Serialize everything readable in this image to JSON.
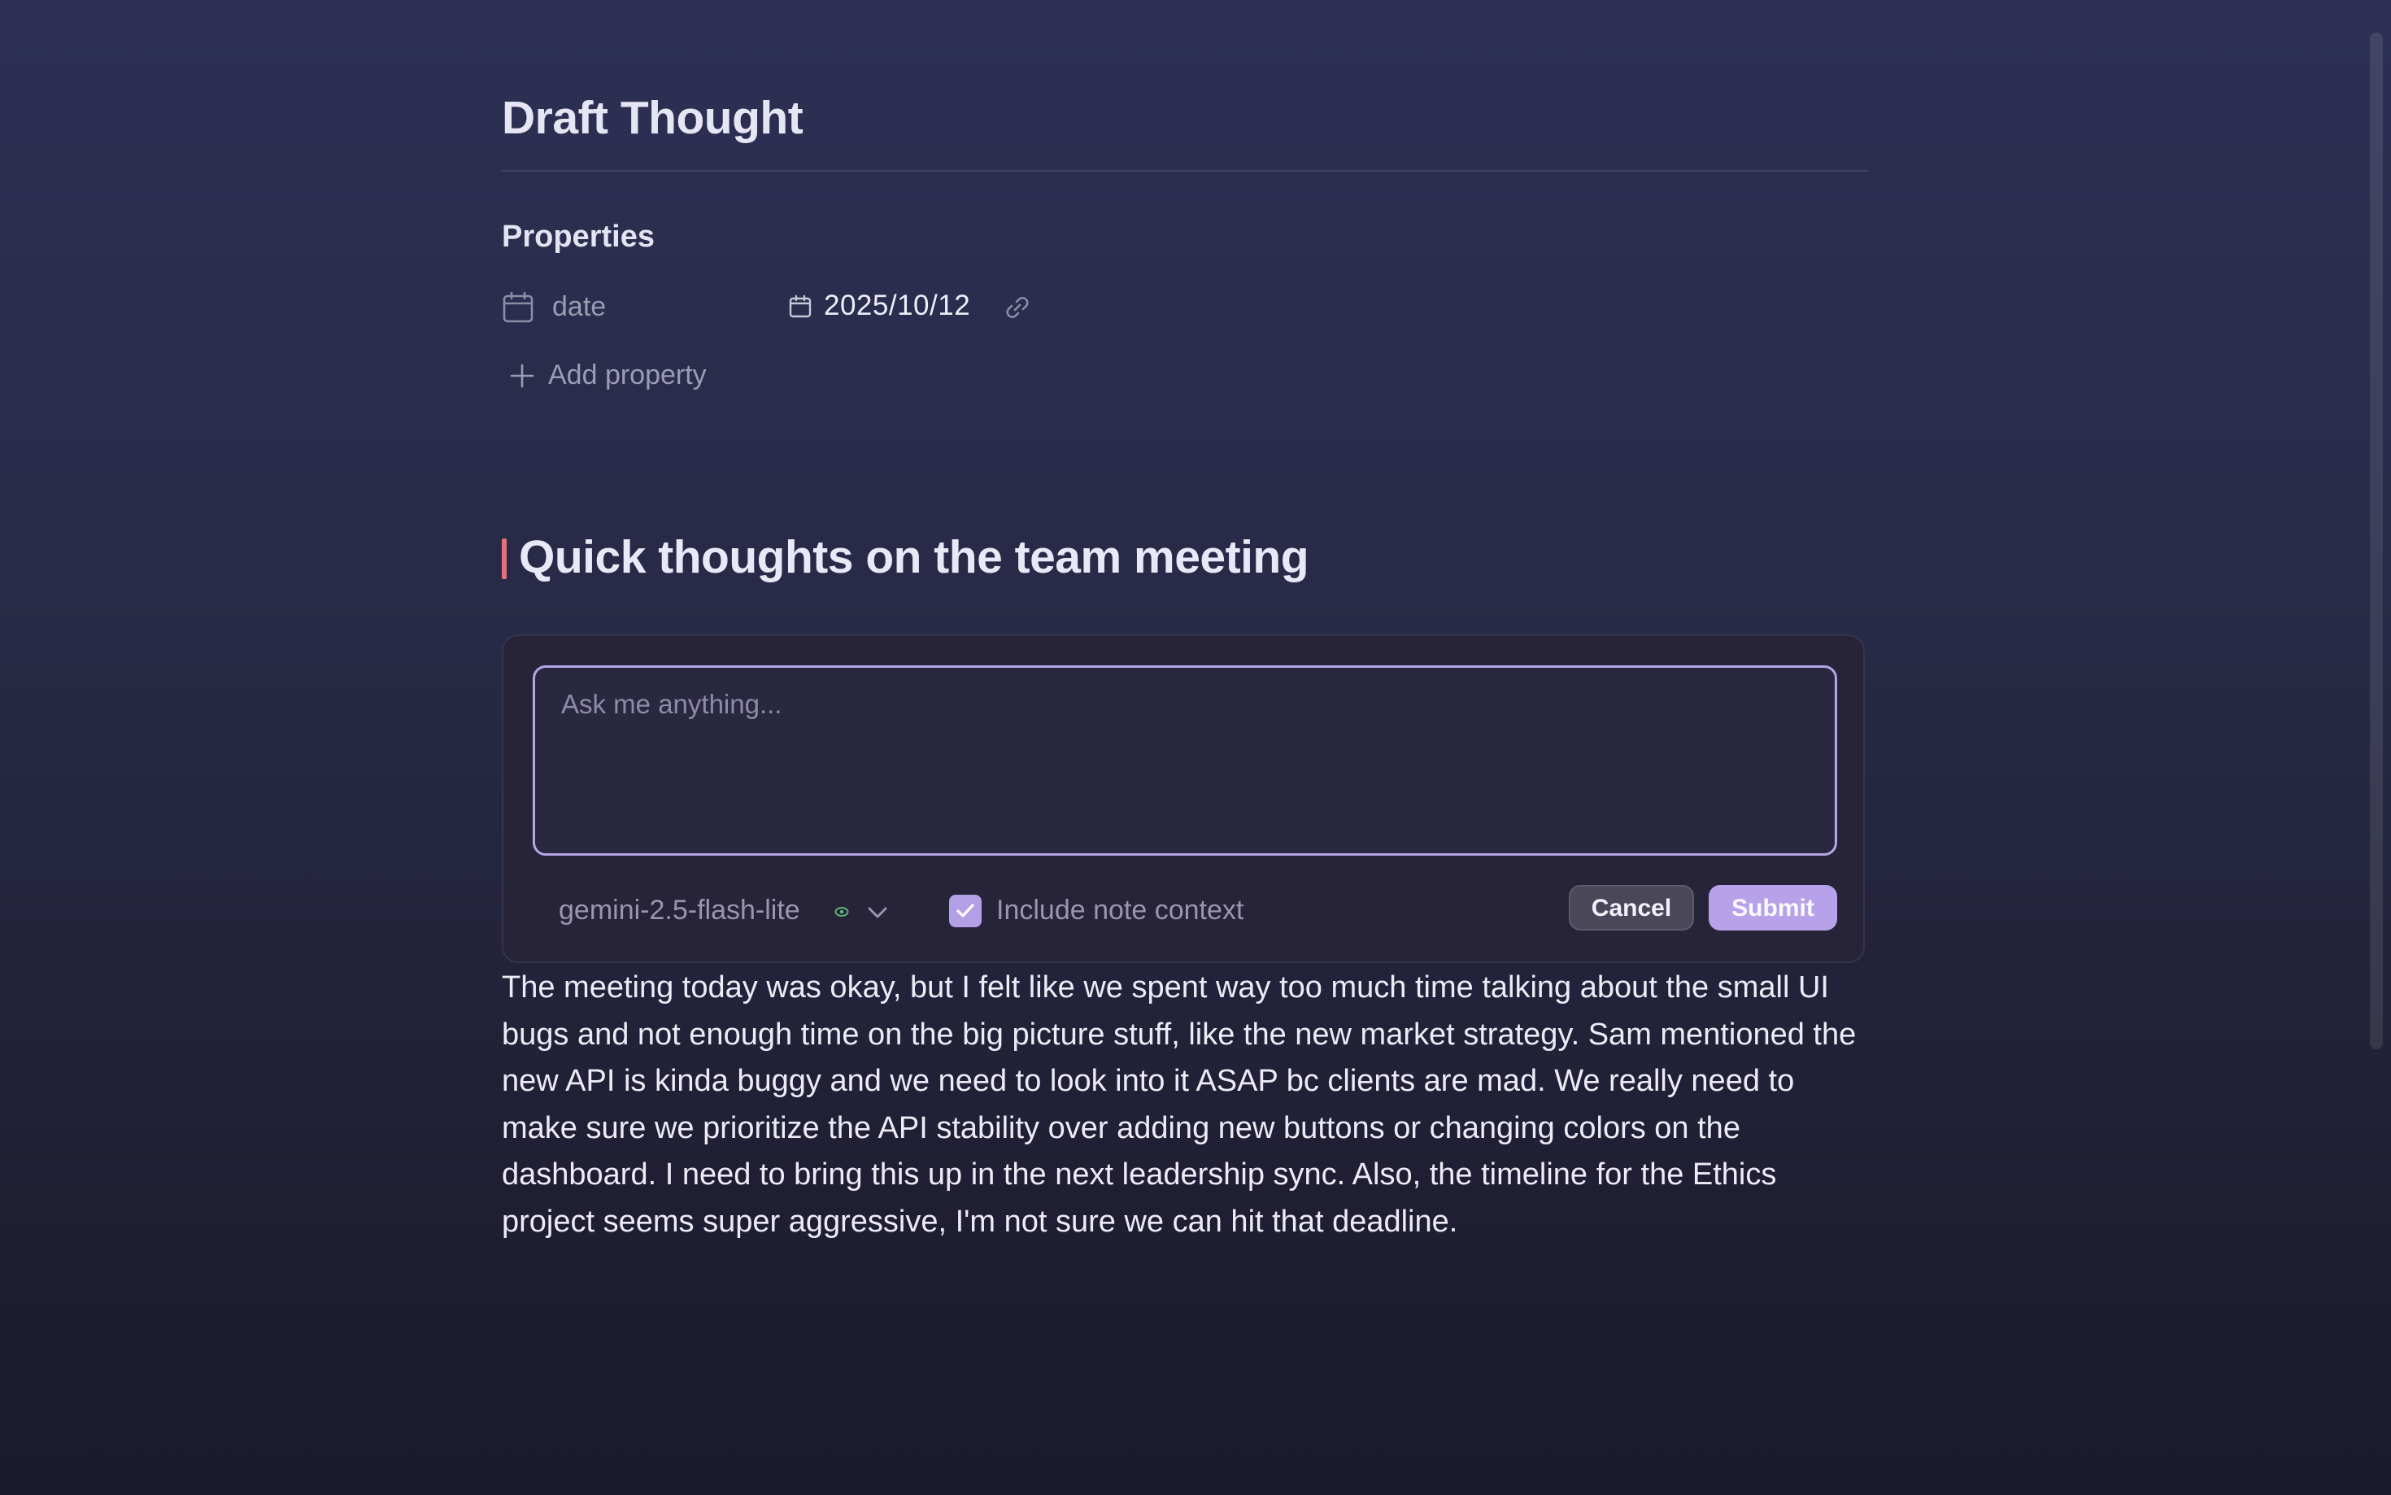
{
  "note": {
    "title": "Draft Thought",
    "properties_heading": "Properties",
    "properties": [
      {
        "icon": "calendar-icon",
        "key": "date",
        "value_icon": "calendar-small-icon",
        "value": "2025/10/12",
        "link_icon": "link-icon"
      }
    ],
    "add_property_label": "Add property",
    "heading": "Quick thoughts on the team meeting",
    "body": "The meeting today was okay, but I felt like we spent way too much time talking about the small UI bugs and not enough time on the big picture stuff, like the new market strategy. Sam mentioned the new API is kinda buggy and we need to look into it ASAP bc clients are mad. We really need to make sure we prioritize the API stability over adding new buttons or changing colors on the dashboard. I need to bring this up in the next leadership sync. Also, the timeline for the Ethics project seems super aggressive, I'm not sure we can hit that deadline."
  },
  "ai_panel": {
    "input_value": "",
    "input_placeholder": "Ask me anything...",
    "model": "gemini-2.5-flash-lite",
    "model_status_icon": "eye-icon",
    "include_context_label": "Include note context",
    "include_context_checked": true,
    "cancel_label": "Cancel",
    "submit_label": "Submit"
  },
  "colors": {
    "accent": "#b7a2ea",
    "cursor_marker": "#e0727a",
    "model_status": "#5fbf7a"
  }
}
